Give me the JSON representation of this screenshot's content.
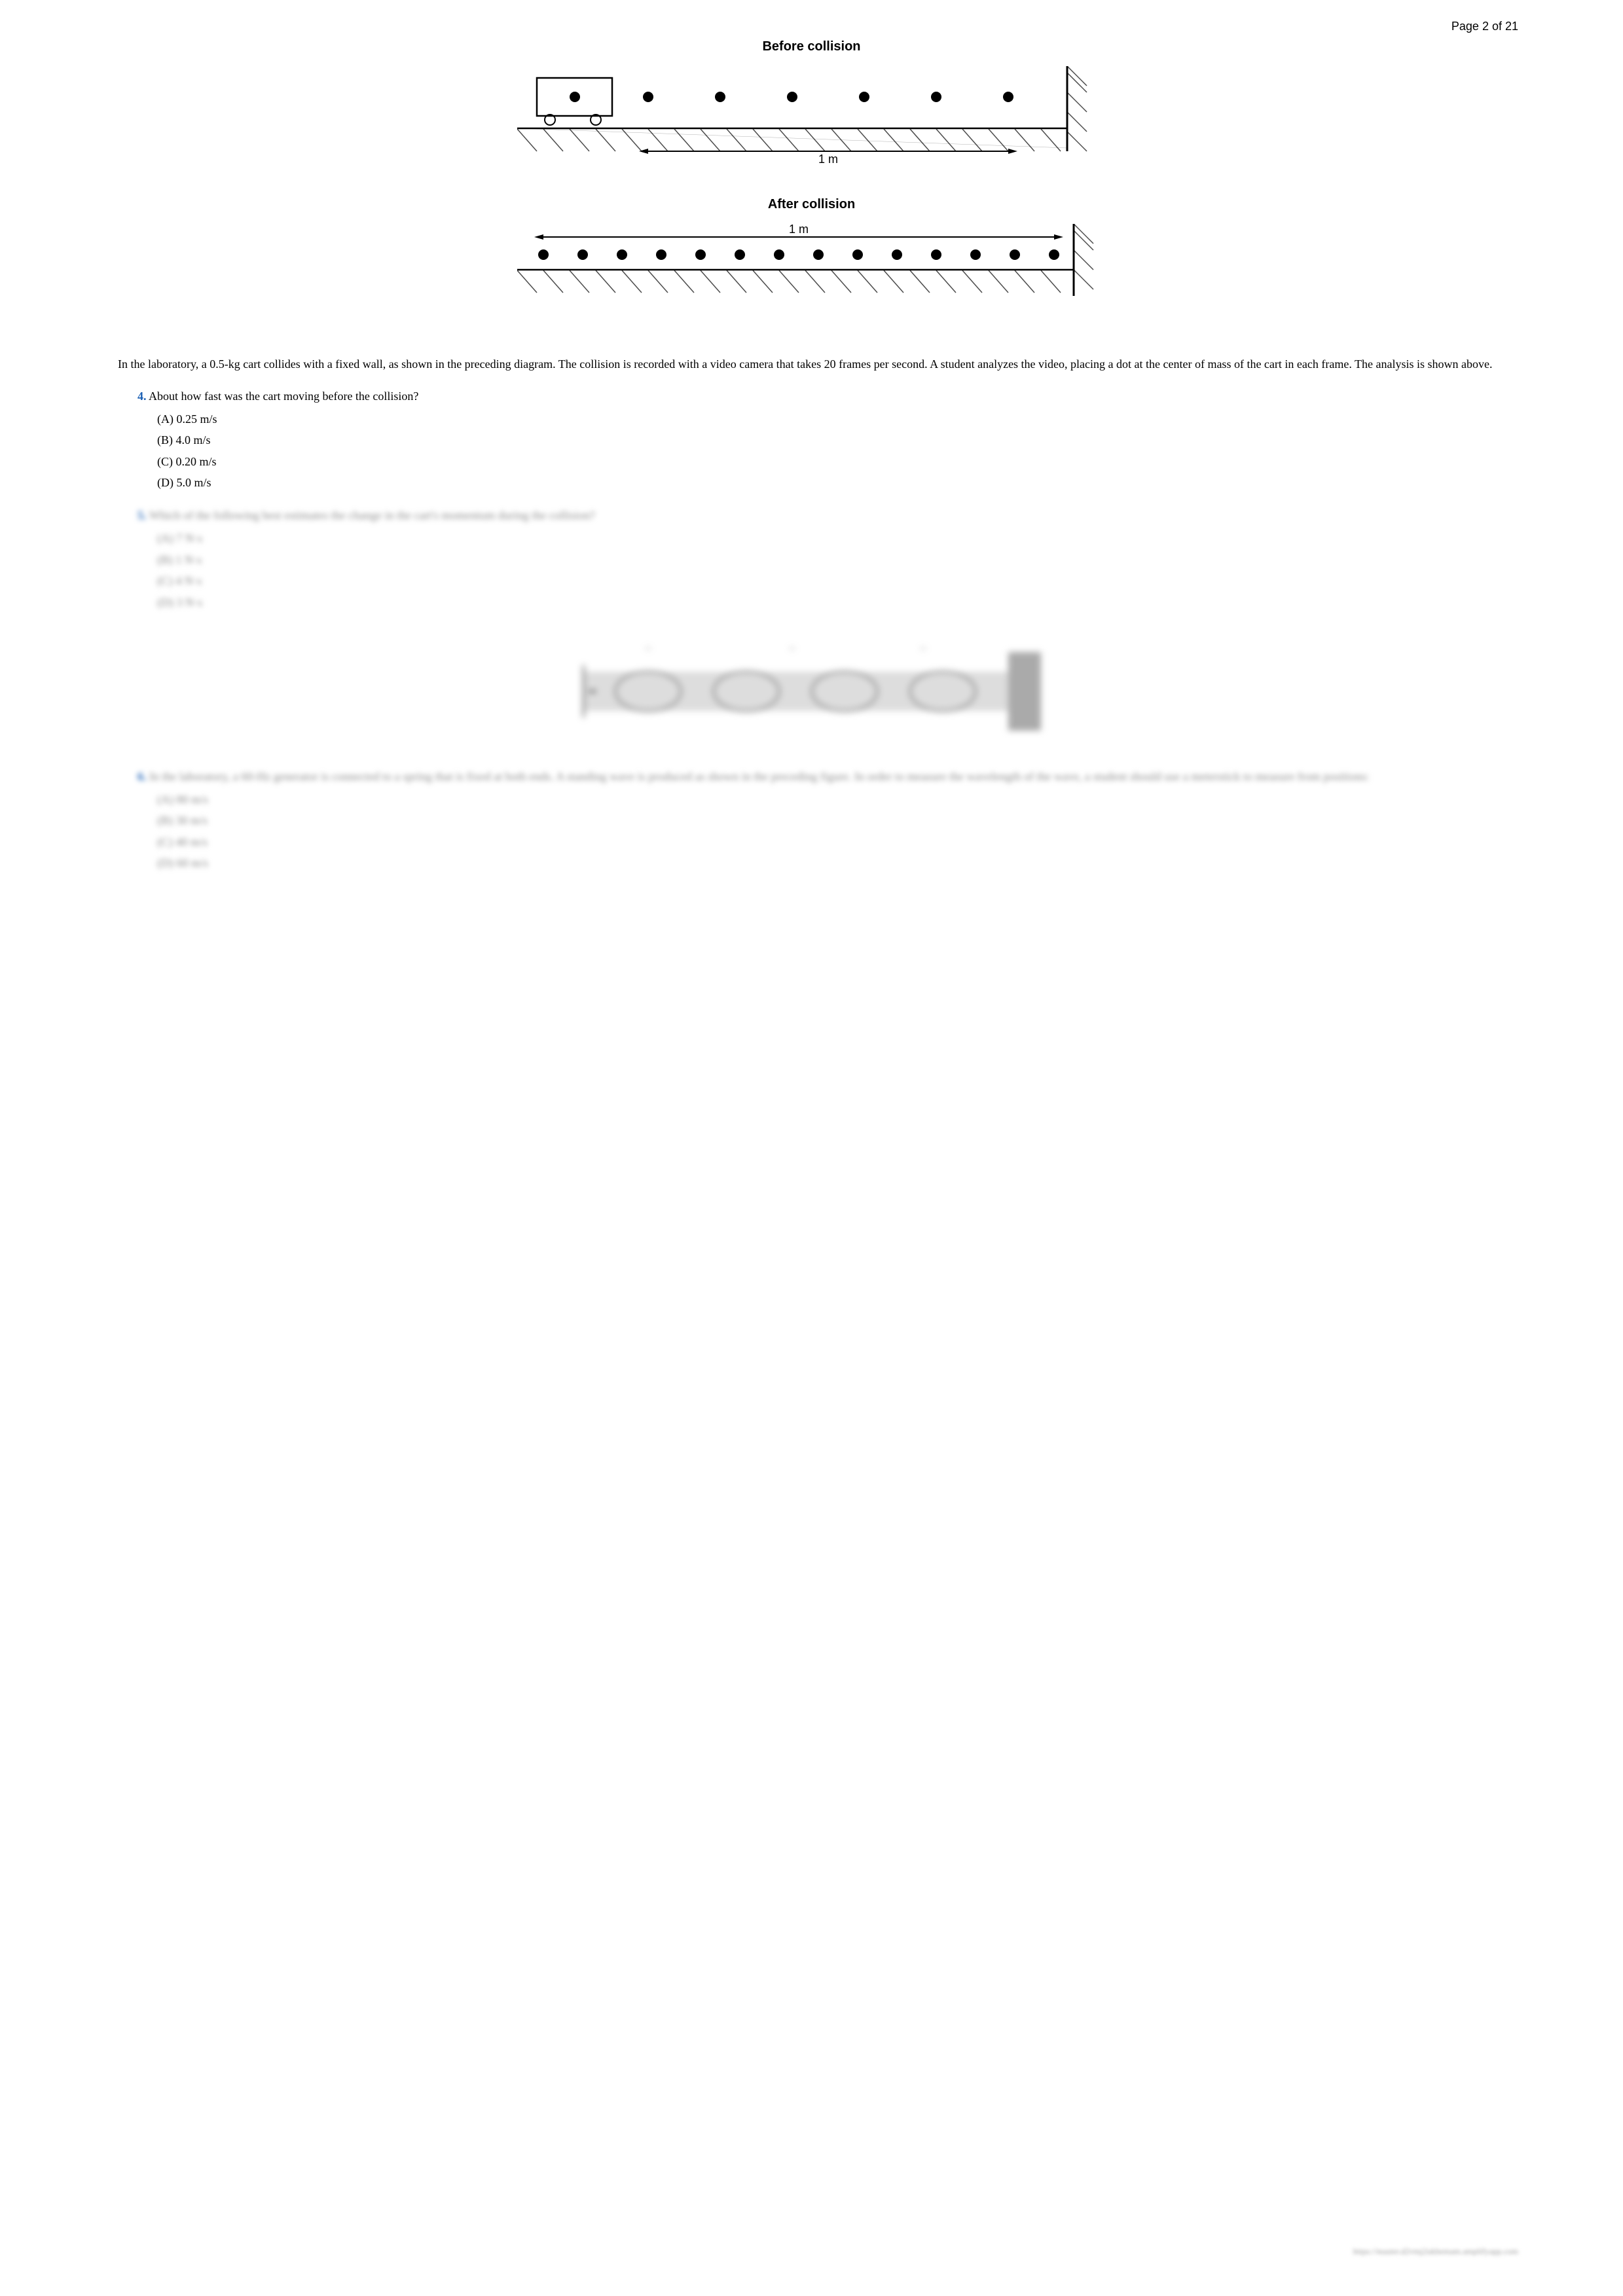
{
  "page": {
    "number": "Page 2 of 21"
  },
  "diagrams": {
    "before_title": "Before collision",
    "after_title": "After collision",
    "measurement_label": "1 m"
  },
  "body_text": "In the laboratory, a 0.5-kg cart collides with a fixed wall, as shown in the preceding diagram. The collision is recorded with a video camera that takes 20 frames per second. A student analyzes the video, placing a dot at the center of mass of the cart in each frame. The analysis is shown above.",
  "questions": [
    {
      "number": "4.",
      "text": "About how fast was the cart moving before the collision?",
      "choices": [
        "(A) 0.25 m/s",
        "(B) 4.0 m/s",
        "(C) 0.20 m/s",
        "(D) 5.0 m/s"
      ]
    },
    {
      "number": "5.",
      "text": "Which of the following best estimates the change in the cart's momentum during the collision?",
      "choices": [
        "(A) 7 N·s",
        "(B) 1 N·s",
        "(C) 4 N·s",
        "(D) 3 N·s"
      ],
      "blurred": true
    }
  ],
  "q6": {
    "number": "6.",
    "text": "In the laboratory, a 60-Hz generator is connected to a spring that is fixed at both ends. A standing wave is produced as shown in the preceding figure. In order to measure the wavelength of the wave, a student should use a meterstick to measure from positions:",
    "choices": [
      "(A) 80 m/s",
      "(B) 30 m/s",
      "(C) 40 m/s",
      "(D) 60 m/s"
    ],
    "blurred": true
  },
  "footer_url": "https://master.d2vtnj2ukhemam.amplifyapp.com"
}
